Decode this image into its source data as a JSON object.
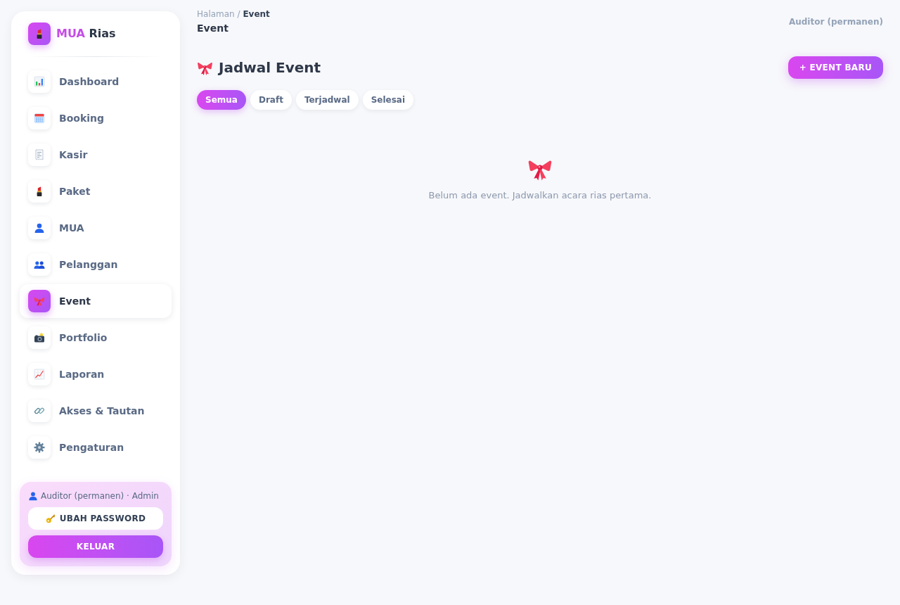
{
  "sidebar": {
    "brand": {
      "name_first": "MUA",
      "name_second": "Rias"
    },
    "items": [
      {
        "label": "Dashboard",
        "selected": false
      },
      {
        "label": "Booking",
        "selected": false
      },
      {
        "label": "Kasir",
        "selected": false
      },
      {
        "label": "Paket",
        "selected": false
      },
      {
        "label": "MUA",
        "selected": false
      },
      {
        "label": "Pelanggan",
        "selected": false
      },
      {
        "label": "Event",
        "selected": true
      },
      {
        "label": "Portfolio",
        "selected": false
      },
      {
        "label": "Laporan",
        "selected": false
      },
      {
        "label": "Akses & Tautan",
        "selected": false
      },
      {
        "label": "Pengaturan",
        "selected": false
      }
    ],
    "user_panel": {
      "user": "Auditor (permanen) · Admin",
      "buttons": [
        {
          "label": "UBAH PASSWORD",
          "kind": "secondary"
        },
        {
          "label": "KELUAR",
          "kind": "primary"
        }
      ]
    }
  },
  "header": {
    "breadcrumb": {
      "parent": "Halaman",
      "separator": "/",
      "current": "Event"
    },
    "title": "Event",
    "user": "Auditor (permanen)"
  },
  "page": {
    "heading": "Jadwal Event",
    "new_button": "+ EVENT BARU",
    "filters": [
      {
        "label": "Semua",
        "selected": true
      },
      {
        "label": "Draft",
        "selected": false
      },
      {
        "label": "Terjadwal",
        "selected": false
      },
      {
        "label": "Selesai",
        "selected": false
      }
    ],
    "empty_state": {
      "message": "Belum ada event. Jadwalkan acara rias pertama."
    }
  }
}
